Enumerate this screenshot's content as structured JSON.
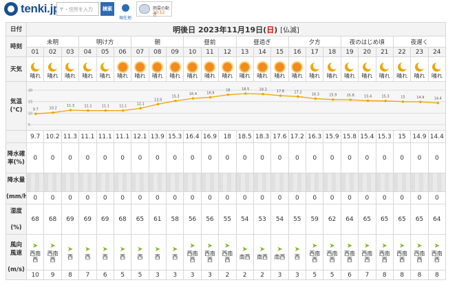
{
  "header": {
    "logo": "tenki.jp",
    "search_placeholder": "〒・住所を入力",
    "search_button": "検索",
    "location_button": "現在地",
    "rain_widget": {
      "title": "雨雲の動き",
      "time": "20:12"
    }
  },
  "table": {
    "corner_label": "日付",
    "date_title": "明後日 2023年11月19日",
    "weekday_open": "(",
    "weekday": "日",
    "weekday_close": ")",
    "rokuyo": "[仏滅]",
    "periods_label": "時刻",
    "periods": [
      "未明",
      "明け方",
      "朝",
      "昼前",
      "昼過ぎ",
      "夕方",
      "夜のはじめ頃",
      "夜遅く"
    ],
    "hours": [
      "01",
      "02",
      "03",
      "04",
      "05",
      "06",
      "07",
      "08",
      "09",
      "10",
      "11",
      "12",
      "13",
      "14",
      "15",
      "16",
      "17",
      "18",
      "19",
      "20",
      "21",
      "22",
      "23",
      "24"
    ],
    "weather_label": "天気",
    "weather_icons": [
      "moon",
      "moon",
      "moon",
      "moon",
      "moon",
      "sun",
      "sun",
      "sun",
      "sun",
      "sun",
      "sun",
      "sun",
      "sun",
      "sun",
      "sun",
      "sun",
      "moon",
      "moon",
      "moon",
      "moon",
      "moon",
      "moon",
      "moon",
      "moon"
    ],
    "weather_text": "晴れ",
    "temp_label": "気温",
    "temp_unit": "(℃)",
    "temp_values": [
      9.7,
      10.2,
      11.3,
      11.1,
      11.1,
      11.1,
      12.1,
      13.9,
      15.3,
      16.4,
      16.9,
      18.0,
      18.5,
      18.3,
      17.6,
      17.2,
      16.3,
      15.9,
      15.8,
      15.4,
      15.3,
      15.0,
      14.9,
      14.4
    ],
    "temp_axis_ticks": [
      "20",
      "15",
      "10",
      "5"
    ],
    "precip_prob_label": "降水確率(%)",
    "precip_prob": [
      "0",
      "0",
      "0",
      "0",
      "0",
      "0",
      "0",
      "0",
      "0",
      "0",
      "0",
      "0",
      "0",
      "0",
      "0",
      "0",
      "0",
      "0",
      "0",
      "0",
      "0",
      "0",
      "0",
      "0"
    ],
    "precip_amount_label": "降水量",
    "precip_amount_unit": "(mm/h)",
    "precip_amount": [
      "0",
      "0",
      "0",
      "0",
      "0",
      "0",
      "0",
      "0",
      "0",
      "0",
      "0",
      "0",
      "0",
      "0",
      "0",
      "0",
      "0",
      "0",
      "0",
      "0",
      "0",
      "0",
      "0",
      "0"
    ],
    "humidity_label": "湿度",
    "humidity_unit": "(%)",
    "humidity": [
      "68",
      "68",
      "69",
      "69",
      "69",
      "68",
      "65",
      "61",
      "58",
      "56",
      "56",
      "55",
      "54",
      "53",
      "54",
      "55",
      "59",
      "62",
      "64",
      "65",
      "65",
      "65",
      "65",
      "64"
    ],
    "wind_label": "風向",
    "wind_label2": "風速",
    "wind_unit": "(m/s)",
    "wind_dir": [
      [
        "西南",
        "西"
      ],
      [
        "西南",
        "西"
      ],
      [
        "西",
        ""
      ],
      [
        "西",
        ""
      ],
      [
        "西",
        ""
      ],
      [
        "西",
        ""
      ],
      [
        "西",
        ""
      ],
      [
        "西",
        ""
      ],
      [
        "西",
        ""
      ],
      [
        "西南",
        "西"
      ],
      [
        "西南",
        "西"
      ],
      [
        "西南",
        "西"
      ],
      [
        "南西",
        ""
      ],
      [
        "南西",
        ""
      ],
      [
        "南西",
        ""
      ],
      [
        "西",
        ""
      ],
      [
        "西南",
        "西"
      ],
      [
        "西南",
        "西"
      ],
      [
        "西南",
        "西"
      ],
      [
        "西南",
        "西"
      ],
      [
        "西南",
        "西"
      ],
      [
        "西南",
        "西"
      ],
      [
        "西南",
        "西"
      ],
      [
        "西南",
        "西"
      ]
    ],
    "wind_speed": [
      "10",
      "9",
      "8",
      "7",
      "6",
      "5",
      "5",
      "3",
      "3",
      "3",
      "3",
      "2",
      "2",
      "2",
      "3",
      "3",
      "5",
      "5",
      "6",
      "7",
      "8",
      "8",
      "8",
      "8"
    ]
  },
  "colors": {
    "accent": "#2d6cb5",
    "sun": "#f28b1c",
    "wind": "#7cba28",
    "temp_line": "#f0a500",
    "holiday": "#e60000"
  }
}
